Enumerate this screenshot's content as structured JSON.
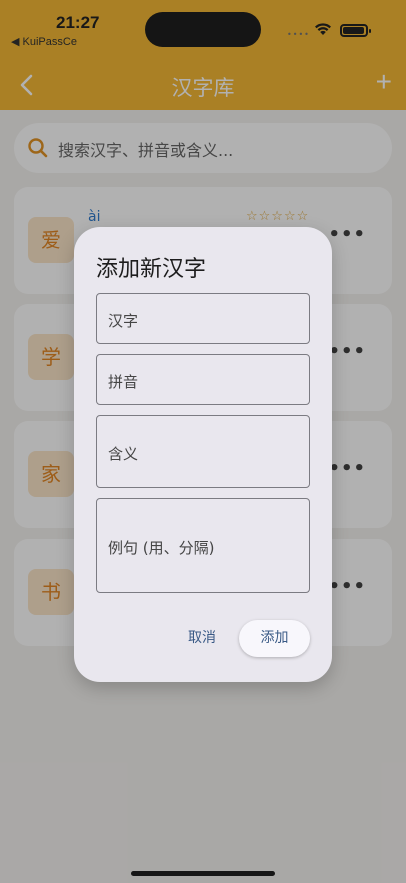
{
  "status_bar": {
    "time": "21:27",
    "back_app": "◀ KuiPassCe",
    "signal_dots": "••••"
  },
  "app_bar": {
    "title": "汉字库",
    "add_label": "+"
  },
  "search": {
    "placeholder": "搜索汉字、拼音或含义..."
  },
  "characters": [
    {
      "char": "爱",
      "pinyin": "ài",
      "stars": "☆☆☆☆☆"
    },
    {
      "char": "学",
      "pinyin": "",
      "stars": ""
    },
    {
      "char": "家",
      "pinyin": "",
      "stars": ""
    },
    {
      "char": "书",
      "pinyin": "",
      "stars": ""
    }
  ],
  "more_label": "•••",
  "dialog": {
    "title": "添加新汉字",
    "fields": [
      {
        "label": "汉字"
      },
      {
        "label": "拼音"
      },
      {
        "label": "含义"
      },
      {
        "label": "例句 (用、分隔)"
      }
    ],
    "cancel_label": "取消",
    "add_label": "添加"
  },
  "colors": {
    "primary": "#f5b324",
    "char_accent": "#e07c12",
    "button_text": "#3a5a86"
  }
}
